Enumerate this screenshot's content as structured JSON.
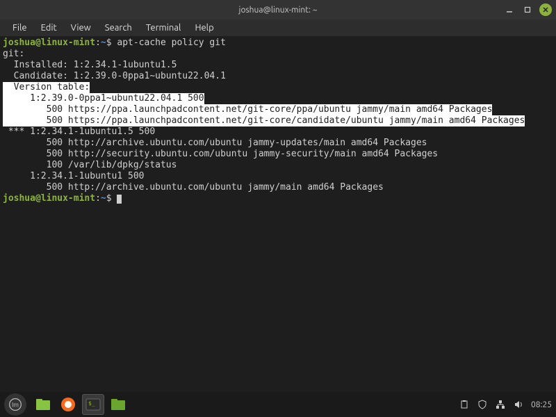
{
  "window": {
    "title": "joshua@linux-mint: ~"
  },
  "menubar": [
    "File",
    "Edit",
    "View",
    "Search",
    "Terminal",
    "Help"
  ],
  "prompt": {
    "userhost": "joshua@linux-mint",
    "sep": ":",
    "path": "~",
    "dollar": "$ "
  },
  "command": "apt-cache policy git",
  "output": {
    "pkg": "git:",
    "installed": "  Installed: 1:2.34.1-1ubuntu1.5",
    "candidate": "  Candidate: 1:2.39.0-0ppa1~ubuntu22.04.1",
    "version_table": "  Version table:",
    "v1_head": "     1:2.39.0-0ppa1~ubuntu22.04.1 500",
    "v1_src1": "        500 https://ppa.launchpadcontent.net/git-core/ppa/ubuntu jammy/main amd64 Packages",
    "v1_src2": "        500 https://ppa.launchpadcontent.net/git-core/candidate/ubuntu jammy/main amd64 Packages",
    "v2_head": " *** 1:2.34.1-1ubuntu1.5 500",
    "v2_src1": "        500 http://archive.ubuntu.com/ubuntu jammy-updates/main amd64 Packages",
    "v2_src2": "        500 http://security.ubuntu.com/ubuntu jammy-security/main amd64 Packages",
    "v2_src3": "        100 /var/lib/dpkg/status",
    "v3_head": "     1:2.34.1-1ubuntu1 500",
    "v3_src1": "        500 http://archive.ubuntu.com/ubuntu jammy/main amd64 Packages"
  },
  "tray": {
    "clock": "08:25"
  }
}
